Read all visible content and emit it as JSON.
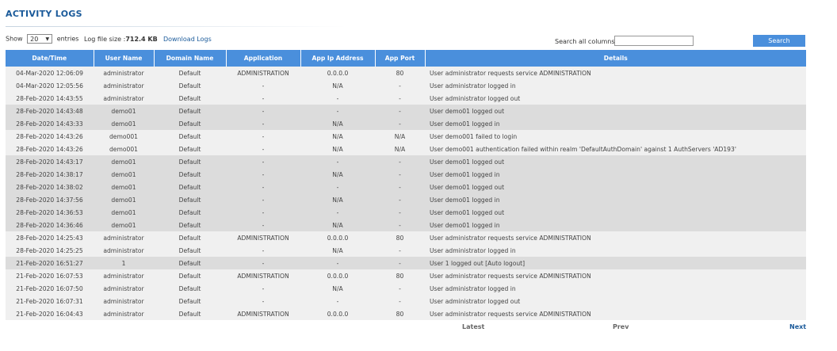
{
  "page": {
    "title": "ACTIVITY LOGS"
  },
  "toolbar": {
    "show_label": "Show",
    "show_value": "20",
    "entries_label": "entries",
    "filesize_label": "Log file size :",
    "filesize_value": "712.4 KB",
    "download_label": "Download Logs",
    "search_label": "Search all columns:",
    "search_value": "",
    "search_button": "Search"
  },
  "table": {
    "columns": [
      "Date/Time",
      "User Name",
      "Domain Name",
      "Application",
      "App Ip Address",
      "App Port",
      "Details"
    ],
    "rows": [
      [
        "04-Mar-2020 12:06:09",
        "administrator",
        "Default",
        "ADMINISTRATION",
        "0.0.0.0",
        "80",
        "User administrator requests service ADMINISTRATION"
      ],
      [
        "04-Mar-2020 12:05:56",
        "administrator",
        "Default",
        "-",
        "N/A",
        "-",
        "User administrator logged in"
      ],
      [
        "28-Feb-2020 14:43:55",
        "administrator",
        "Default",
        "-",
        "-",
        "-",
        "User administrator logged out"
      ],
      [
        "28-Feb-2020 14:43:48",
        "demo01",
        "Default",
        "-",
        "-",
        "-",
        "User demo01 logged out"
      ],
      [
        "28-Feb-2020 14:43:33",
        "demo01",
        "Default",
        "-",
        "N/A",
        "-",
        "User demo01 logged in"
      ],
      [
        "28-Feb-2020 14:43:26",
        "demo001",
        "Default",
        "-",
        "N/A",
        "N/A",
        "User demo001 failed to login"
      ],
      [
        "28-Feb-2020 14:43:26",
        "demo001",
        "Default",
        "-",
        "N/A",
        "N/A",
        "User demo001 authentication failed within realm 'DefaultAuthDomain' against 1 AuthServers 'AD193'"
      ],
      [
        "28-Feb-2020 14:43:17",
        "demo01",
        "Default",
        "-",
        "-",
        "-",
        "User demo01 logged out"
      ],
      [
        "28-Feb-2020 14:38:17",
        "demo01",
        "Default",
        "-",
        "N/A",
        "-",
        "User demo01 logged in"
      ],
      [
        "28-Feb-2020 14:38:02",
        "demo01",
        "Default",
        "-",
        "-",
        "-",
        "User demo01 logged out"
      ],
      [
        "28-Feb-2020 14:37:56",
        "demo01",
        "Default",
        "-",
        "N/A",
        "-",
        "User demo01 logged in"
      ],
      [
        "28-Feb-2020 14:36:53",
        "demo01",
        "Default",
        "-",
        "-",
        "-",
        "User demo01 logged out"
      ],
      [
        "28-Feb-2020 14:36:46",
        "demo01",
        "Default",
        "-",
        "N/A",
        "-",
        "User demo01 logged in"
      ],
      [
        "28-Feb-2020 14:25:43",
        "administrator",
        "Default",
        "ADMINISTRATION",
        "0.0.0.0",
        "80",
        "User administrator requests service ADMINISTRATION"
      ],
      [
        "28-Feb-2020 14:25:25",
        "administrator",
        "Default",
        "-",
        "N/A",
        "-",
        "User administrator logged in"
      ],
      [
        "21-Feb-2020 16:51:27",
        "1",
        "Default",
        "-",
        "-",
        "-",
        "User 1 logged out [Auto logout]"
      ],
      [
        "21-Feb-2020 16:07:53",
        "administrator",
        "Default",
        "ADMINISTRATION",
        "0.0.0.0",
        "80",
        "User administrator requests service ADMINISTRATION"
      ],
      [
        "21-Feb-2020 16:07:50",
        "administrator",
        "Default",
        "-",
        "N/A",
        "-",
        "User administrator logged in"
      ],
      [
        "21-Feb-2020 16:07:31",
        "administrator",
        "Default",
        "-",
        "-",
        "-",
        "User administrator logged out"
      ],
      [
        "21-Feb-2020 16:04:43",
        "administrator",
        "Default",
        "ADMINISTRATION",
        "0.0.0.0",
        "80",
        "User administrator requests service ADMINISTRATION"
      ]
    ],
    "row_shading": [
      "light",
      "light",
      "light",
      "dark",
      "dark",
      "light",
      "light",
      "dark",
      "dark",
      "dark",
      "dark",
      "dark",
      "dark",
      "light",
      "light",
      "dark",
      "light",
      "light",
      "light",
      "light"
    ]
  },
  "pager": {
    "latest": "Latest",
    "prev": "Prev",
    "next": "Next"
  },
  "colors": {
    "accent": "#4a8fdc",
    "title": "#1a5a9a",
    "row_light": "#f0f0f0",
    "row_dark": "#dcdcdc"
  }
}
